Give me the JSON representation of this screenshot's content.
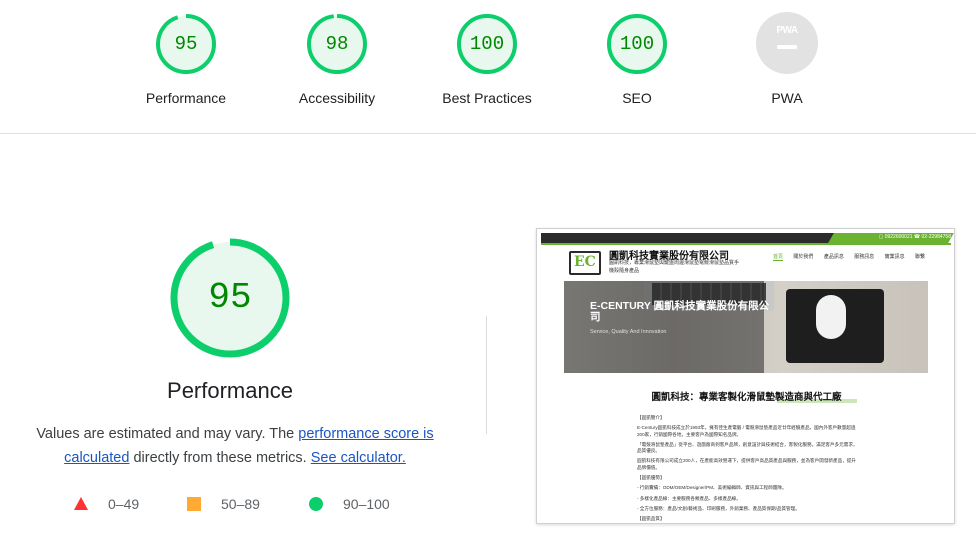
{
  "gauges": [
    {
      "score": "95",
      "label": "Performance",
      "color": "#0cce6b"
    },
    {
      "score": "98",
      "label": "Accessibility",
      "color": "#0cce6b"
    },
    {
      "score": "100",
      "label": "Best Practices",
      "color": "#0cce6b"
    },
    {
      "score": "100",
      "label": "SEO",
      "color": "#0cce6b"
    },
    {
      "score": "PWA",
      "label": "PWA",
      "color": "#e2e2e2"
    }
  ],
  "main": {
    "score": "95",
    "title": "Performance",
    "desc_prefix": "Values are estimated and may vary. The ",
    "desc_link": "performance score is calculated",
    "desc_middle": " directly from these metrics. ",
    "desc_link2": "See calculator."
  },
  "legend": [
    {
      "range": "0–49",
      "color": "#ff3333",
      "shape": "triangle"
    },
    {
      "range": "50–89",
      "color": "#ffaa33",
      "shape": "square"
    },
    {
      "range": "90–100",
      "color": "#0cce6b",
      "shape": "circle"
    }
  ],
  "thumbnail": {
    "phones": "▢ 0922600021   ☎ 02-22984758",
    "logo_text": "EC",
    "company": "圓凱科技實業股份有限公司",
    "company_sub": "圓凱科技，專業滑鼠墊與鍵盤周邊滑鼠墊電競滑鼠墊品質手機殼隨身產品",
    "nav": [
      "首頁",
      "關於我們",
      "產品訊息",
      "服務訊息",
      "實業訊息",
      "聯繫"
    ],
    "hero_title": "E-CENTURY 圓凱科技實業股份有限公司",
    "hero_sub": "Service, Quality And Innovation",
    "headline": "圓凱科技：專業客製化滑鼠墊製造商與代工廠",
    "body": [
      "【圓凱簡介】",
      "E-Century圓凱科技成立於1993年，擁有佳生產電腦 / 電競滑鼠墊產品近廿年經驗產品，國內外客戶數量超過200家，行銷國際各地，主要客戶為國際知名品牌。",
      "「電競滑鼠墊產品」從平台、遊戲廠商到客戶品牌，創意設計與技術結合，客製化服務，滿足客戶多元需求，品質優良。",
      "圓凱科技有限公司成立200人，在產能高效營運下，提供客戶高品質產品與服務，並為客戶開發新產品，提升品牌價值。",
      "【圓凱優勢】",
      "- 行銷實績：ODM/OEM/Designer/PM、美術編輯師、資訊與工程師團隊。",
      "- 多樣化產品線：主要服務各類產品、多樣產品線。",
      "- 全方位服務：產品/文創/藝術品、印刷服務，外銷業務、產品質保期/品質管理。",
      "【圓凱品質】"
    ]
  }
}
